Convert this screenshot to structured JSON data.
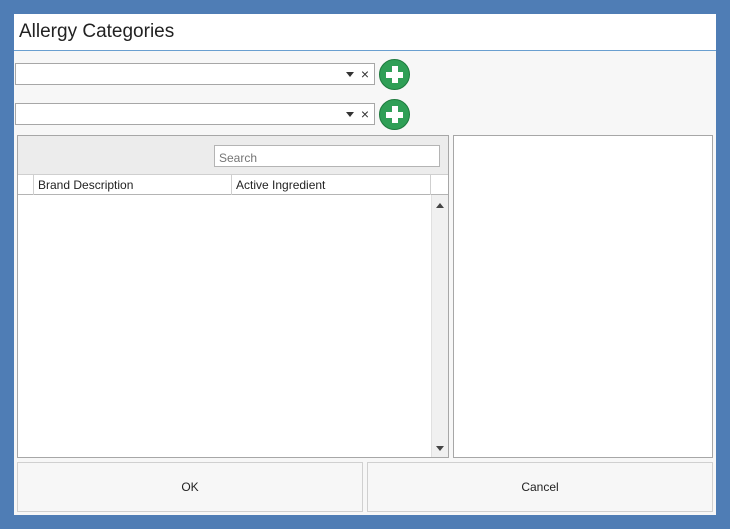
{
  "window": {
    "title": "Allergy Categories"
  },
  "combos": [
    {
      "value": "",
      "dropdown_icon": "chevron-down-icon",
      "clear_icon": "close-icon",
      "clear_glyph": "×"
    },
    {
      "value": "",
      "dropdown_icon": "chevron-down-icon",
      "clear_icon": "close-icon",
      "clear_glyph": "×"
    }
  ],
  "add_button_icon": "plus-circle-icon",
  "grid": {
    "search_placeholder": "Search",
    "columns": [
      "",
      "Brand Description",
      "Active Ingredient"
    ],
    "rows": []
  },
  "buttons": {
    "ok": "OK",
    "cancel": "Cancel"
  },
  "colors": {
    "background": "#4f7db5",
    "accent_line": "#6a9fd0",
    "add_green": "#2f9f56"
  }
}
